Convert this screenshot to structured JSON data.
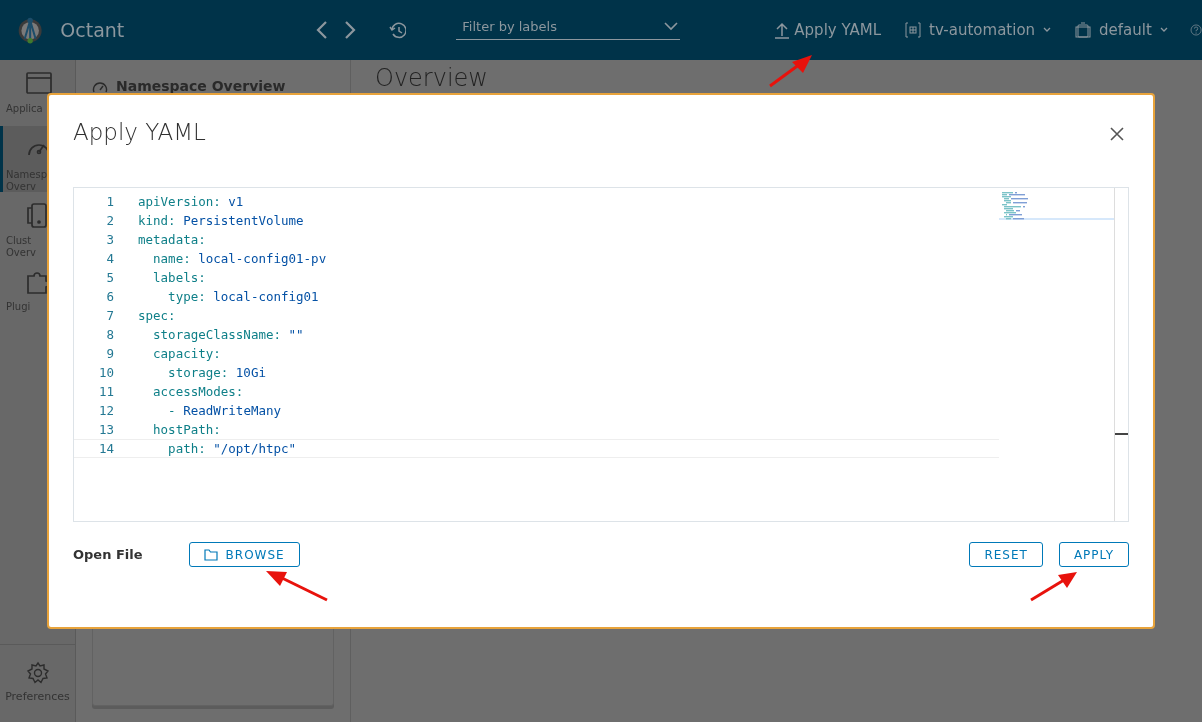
{
  "header": {
    "app_name": "Octant",
    "filter": {
      "placeholder": "Filter by labels"
    },
    "apply_yaml": "Apply YAML",
    "namespace": "tv-automation",
    "context": "default"
  },
  "sidebar": {
    "items": [
      {
        "kind": "window",
        "lines": [
          "Applica"
        ],
        "selected": false
      },
      {
        "kind": "gauge",
        "lines": [
          "Namesp",
          "Overv"
        ],
        "selected": true
      },
      {
        "kind": "device",
        "lines": [
          "Clust",
          "Overv"
        ],
        "selected": false
      },
      {
        "kind": "puzzle",
        "lines": [
          "Plugi"
        ],
        "selected": false
      }
    ],
    "preferences": "Preferences"
  },
  "panel": {
    "title": "Namespace Overview"
  },
  "main": {
    "heading": "Overview"
  },
  "modal": {
    "title": "Apply YAML",
    "editor": {
      "lines": [
        {
          "number": "1",
          "key": "apiVersion:",
          "value": "v1",
          "selected": false
        },
        {
          "number": "2",
          "key": "kind:",
          "value": "PersistentVolume",
          "selected": false
        },
        {
          "number": "3",
          "key": "metadata:",
          "selected": false
        },
        {
          "number": "4",
          "key": "  name:",
          "value": "local-config01-pv",
          "selected": false
        },
        {
          "number": "5",
          "key": "  labels:",
          "selected": false
        },
        {
          "number": "6",
          "key": "    type:",
          "value": "local-config01",
          "selected": false
        },
        {
          "number": "7",
          "key": "spec:",
          "selected": false
        },
        {
          "number": "8",
          "key": "  storageClassName:",
          "value": "\"\"",
          "selected": false
        },
        {
          "number": "9",
          "key": "  capacity:",
          "selected": false
        },
        {
          "number": "10",
          "key": "    storage:",
          "value": "10Gi",
          "selected": false
        },
        {
          "number": "11",
          "key": "  accessModes:",
          "selected": false
        },
        {
          "number": "12",
          "key": "    -",
          "value": "ReadWriteMany",
          "selected": false
        },
        {
          "number": "13",
          "key": "  hostPath:",
          "selected": false
        },
        {
          "number": "14",
          "key": "    path:",
          "value": "\"/opt/htpc\"",
          "selected": true
        }
      ]
    },
    "open_file_label": "Open File",
    "buttons": [
      {
        "kind": "browse",
        "label": "BROWSE"
      },
      {
        "kind": "reset",
        "label": "RESET"
      },
      {
        "kind": "apply",
        "label": "APPLY"
      }
    ]
  }
}
